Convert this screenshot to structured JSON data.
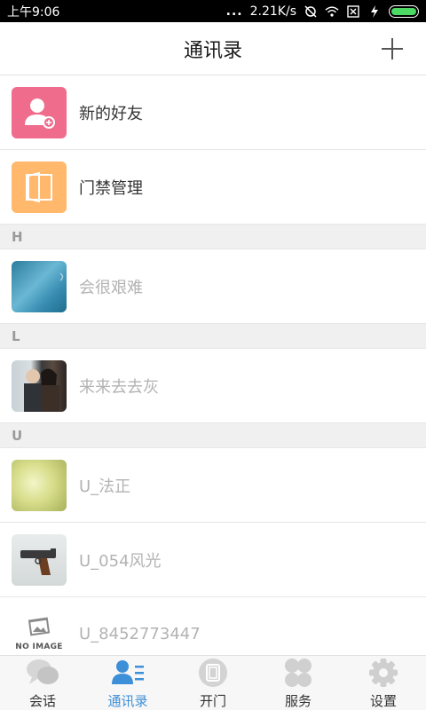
{
  "status_bar": {
    "time": "上午9:06",
    "dots": "...",
    "speed": "2.21K/s"
  },
  "header": {
    "title": "通讯录"
  },
  "list": {
    "fixed": [
      {
        "label": "新的好友",
        "icon": "add-friend-icon"
      },
      {
        "label": "门禁管理",
        "icon": "door-icon"
      }
    ],
    "sections": [
      {
        "letter": "H",
        "contacts": [
          {
            "name": "会很艰难"
          }
        ]
      },
      {
        "letter": "L",
        "contacts": [
          {
            "name": "来来去去灰"
          }
        ]
      },
      {
        "letter": "U",
        "contacts": [
          {
            "name": "U_法正"
          },
          {
            "name": "U_054风光"
          },
          {
            "name": "U_8452773447"
          }
        ]
      }
    ],
    "no_image_text": "NO IMAGE"
  },
  "bottom_nav": {
    "items": [
      {
        "label": "会话",
        "icon": "chat-icon"
      },
      {
        "label": "通讯录",
        "icon": "contacts-icon",
        "active": true
      },
      {
        "label": "开门",
        "icon": "open-door-icon"
      },
      {
        "label": "服务",
        "icon": "services-icon"
      },
      {
        "label": "设置",
        "icon": "settings-icon"
      }
    ]
  },
  "colors": {
    "accent": "#3d8fd8",
    "new_friend_bg": "#f06c8c",
    "door_bg": "#ffb86c",
    "battery": "#4cd964"
  }
}
